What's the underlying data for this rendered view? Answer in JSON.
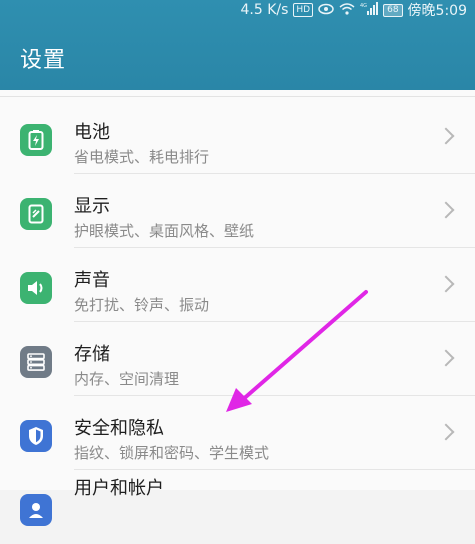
{
  "status": {
    "speed": "4.5 K/s",
    "hd": "HD",
    "signal_label": "4G",
    "battery": "68",
    "time": "傍晚5:09"
  },
  "header": {
    "title": "设置"
  },
  "items": [
    {
      "label": "电池",
      "sub": "省电模式、耗电排行",
      "icon": "battery-icon",
      "color": "#3cb371"
    },
    {
      "label": "显示",
      "sub": "护眼模式、桌面风格、壁纸",
      "icon": "display-icon",
      "color": "#3cb371"
    },
    {
      "label": "声音",
      "sub": "免打扰、铃声、振动",
      "icon": "speaker-icon",
      "color": "#3cb371"
    },
    {
      "label": "存储",
      "sub": "内存、空间清理",
      "icon": "storage-icon",
      "color": "#707b87"
    },
    {
      "label": "安全和隐私",
      "sub": "指纹、锁屏和密码、学生模式",
      "icon": "shield-icon",
      "color": "#3f74d4"
    },
    {
      "label": "用户和帐户",
      "sub": "",
      "icon": "user-icon",
      "color": "#3f74d4"
    }
  ],
  "annotation": {
    "color": "#e026e6"
  }
}
